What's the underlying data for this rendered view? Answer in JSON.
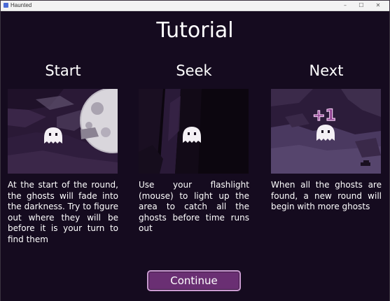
{
  "window": {
    "title": "Haunted",
    "controls": [
      "–",
      "☐",
      "✕"
    ]
  },
  "page": {
    "heading": "Tutorial"
  },
  "columns": [
    {
      "title": "Start",
      "description": "At the start of the round, the ghosts will fade into the darkness. Try to figure out where they will be before it is your turn to find them"
    },
    {
      "title": "Seek",
      "description": "Use your flashlight (mouse) to light up the area to catch all the ghosts before time runs out"
    },
    {
      "title": "Next",
      "description": "When all the ghosts are found, a new round will begin with more ghosts",
      "score_popup": "+1"
    }
  ],
  "buttons": {
    "continue_label": "Continue"
  },
  "colors": {
    "background": "#150b1f",
    "button_fill": "#6a2f73",
    "button_border": "#c99ad0",
    "score_popup": "#8a3a8c"
  }
}
